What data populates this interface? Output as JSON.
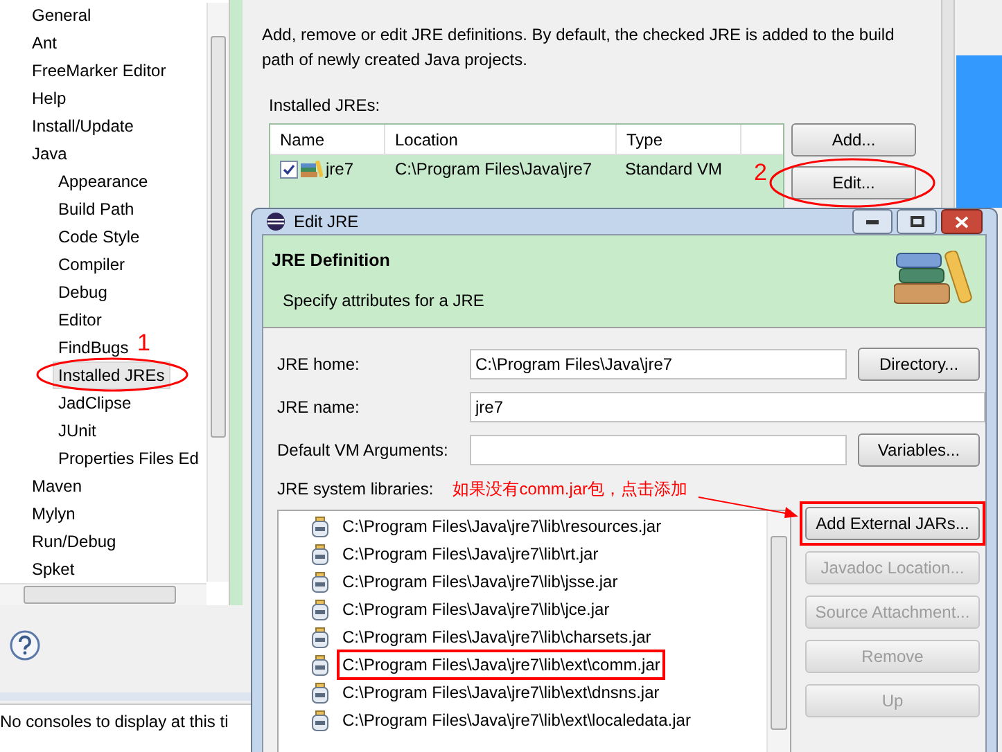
{
  "preferences": {
    "tree": [
      {
        "label": "General",
        "selected": false
      },
      {
        "label": "Ant",
        "selected": false
      },
      {
        "label": "FreeMarker Editor",
        "selected": false
      },
      {
        "label": "Help",
        "selected": false
      },
      {
        "label": "Install/Update",
        "selected": false
      },
      {
        "label": "Java",
        "selected": false,
        "children": [
          {
            "label": "Appearance",
            "selected": false
          },
          {
            "label": "Build Path",
            "selected": false
          },
          {
            "label": "Code Style",
            "selected": false
          },
          {
            "label": "Compiler",
            "selected": false
          },
          {
            "label": "Debug",
            "selected": false
          },
          {
            "label": "Editor",
            "selected": false
          },
          {
            "label": "FindBugs",
            "selected": false
          },
          {
            "label": "Installed JREs",
            "selected": true
          },
          {
            "label": "JadClipse",
            "selected": false
          },
          {
            "label": "JUnit",
            "selected": false
          },
          {
            "label": "Properties Files Ed",
            "selected": false
          }
        ]
      },
      {
        "label": "Maven",
        "selected": false
      },
      {
        "label": "Mylyn",
        "selected": false
      },
      {
        "label": "Run/Debug",
        "selected": false
      },
      {
        "label": "Spket",
        "selected": false
      }
    ],
    "description": "Add, remove or edit JRE definitions. By default, the checked JRE is added to the build path of newly created Java projects.",
    "installed_label": "Installed JREs:",
    "jre_table": {
      "columns": [
        "Name",
        "Location",
        "Type"
      ],
      "rows": [
        {
          "name": "jre7",
          "location": "C:\\Program Files\\Java\\jre7",
          "type": "Standard VM",
          "checked": true,
          "selected": true
        }
      ]
    },
    "buttons": [
      "Add...",
      "Edit..."
    ],
    "console": "No consoles to display at this ti"
  },
  "annotations": {
    "step_1": "1",
    "step_2": "2",
    "note": "如果没有comm.jar包，点击添加"
  },
  "dialog": {
    "title": "Edit JRE",
    "header_title": "JRE Definition",
    "header_subtitle": "Specify attributes for a JRE",
    "fields": [
      {
        "label": "JRE home:",
        "value": "C:\\Program Files\\Java\\jre7",
        "button": "Directory..."
      },
      {
        "label": "JRE name:",
        "value": "jre7"
      },
      {
        "label": "Default VM Arguments:",
        "button": "Variables..."
      }
    ],
    "libraries_label": "JRE system libraries:",
    "libraries": [
      {
        "path": "C:\\Program Files\\Java\\jre7\\lib\\resources.jar",
        "highlighted": false
      },
      {
        "path": "C:\\Program Files\\Java\\jre7\\lib\\rt.jar",
        "highlighted": false
      },
      {
        "path": "C:\\Program Files\\Java\\jre7\\lib\\jsse.jar",
        "highlighted": false
      },
      {
        "path": "C:\\Program Files\\Java\\jre7\\lib\\jce.jar",
        "highlighted": false
      },
      {
        "path": "C:\\Program Files\\Java\\jre7\\lib\\charsets.jar",
        "highlighted": false
      },
      {
        "path": "C:\\Program Files\\Java\\jre7\\lib\\ext\\comm.jar",
        "highlighted": true
      },
      {
        "path": "C:\\Program Files\\Java\\jre7\\lib\\ext\\dnsns.jar",
        "highlighted": false
      },
      {
        "path": "C:\\Program Files\\Java\\jre7\\lib\\ext\\localedata.jar",
        "highlighted": false
      }
    ],
    "side_buttons": [
      {
        "label": "Add External JARs...",
        "disabled": false,
        "highlighted": true
      },
      {
        "label": "Javadoc Location...",
        "disabled": true,
        "highlighted": false
      },
      {
        "label": "Source Attachment...",
        "disabled": true,
        "highlighted": false
      },
      {
        "label": "Remove",
        "disabled": true,
        "highlighted": false
      },
      {
        "label": "Up",
        "disabled": true,
        "highlighted": false
      }
    ]
  }
}
